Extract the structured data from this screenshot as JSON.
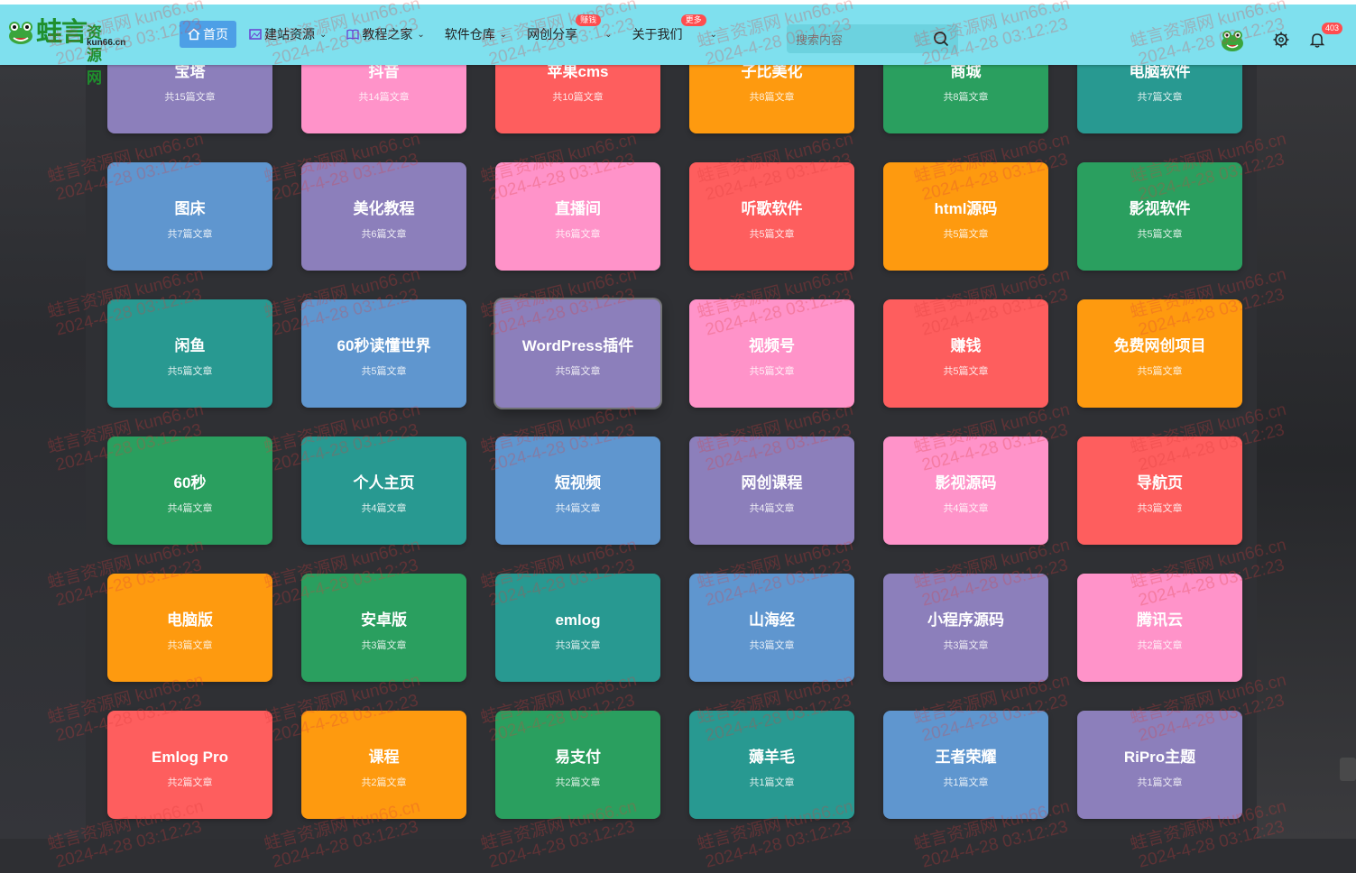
{
  "header": {
    "logo_title": "蛙言",
    "logo_top": "资源网",
    "logo_sub": "kun66.cn",
    "nav": [
      {
        "label": "首页",
        "active": true,
        "badge": ""
      },
      {
        "label": "建站资源",
        "active": false,
        "badge": ""
      },
      {
        "label": "教程之家",
        "active": false,
        "badge": ""
      },
      {
        "label": "软件仓库",
        "active": false,
        "badge": ""
      },
      {
        "label": "网创分享",
        "active": false,
        "badge": "赚钱"
      },
      {
        "label": "关于我们",
        "active": false,
        "badge": "更多"
      }
    ],
    "search_placeholder": "搜索内容",
    "notification_count": "403"
  },
  "categories": [
    {
      "name": "宝塔",
      "count": "共15篇文章",
      "color": "#8c7fbb"
    },
    {
      "name": "抖音",
      "count": "共14篇文章",
      "color": "#ff93c9"
    },
    {
      "name": "苹果cms",
      "count": "共10篇文章",
      "color": "#fe5e5e"
    },
    {
      "name": "子比美化",
      "count": "共8篇文章",
      "color": "#fe9a0f"
    },
    {
      "name": "商城",
      "count": "共8篇文章",
      "color": "#2a9f5f"
    },
    {
      "name": "电脑软件",
      "count": "共7篇文章",
      "color": "#289991"
    },
    {
      "name": "图床",
      "count": "共7篇文章",
      "color": "#5f96cf"
    },
    {
      "name": "美化教程",
      "count": "共6篇文章",
      "color": "#8c7fbb"
    },
    {
      "name": "直播间",
      "count": "共6篇文章",
      "color": "#ff93c9"
    },
    {
      "name": "听歌软件",
      "count": "共5篇文章",
      "color": "#fe5e5e"
    },
    {
      "name": "html源码",
      "count": "共5篇文章",
      "color": "#fe9a0f"
    },
    {
      "name": "影视软件",
      "count": "共5篇文章",
      "color": "#2a9f5f"
    },
    {
      "name": "闲鱼",
      "count": "共5篇文章",
      "color": "#289991"
    },
    {
      "name": "60秒读懂世界",
      "count": "共5篇文章",
      "color": "#5f96cf"
    },
    {
      "name": "WordPress插件",
      "count": "共5篇文章",
      "color": "#8c7fbb"
    },
    {
      "name": "视频号",
      "count": "共5篇文章",
      "color": "#ff93c9"
    },
    {
      "name": "赚钱",
      "count": "共5篇文章",
      "color": "#fe5e5e"
    },
    {
      "name": "免费网创项目",
      "count": "共5篇文章",
      "color": "#fe9a0f"
    },
    {
      "name": "60秒",
      "count": "共4篇文章",
      "color": "#2a9f5f"
    },
    {
      "name": "个人主页",
      "count": "共4篇文章",
      "color": "#289991"
    },
    {
      "name": "短视频",
      "count": "共4篇文章",
      "color": "#5f96cf"
    },
    {
      "name": "网创课程",
      "count": "共4篇文章",
      "color": "#8c7fbb"
    },
    {
      "name": "影视源码",
      "count": "共4篇文章",
      "color": "#ff93c9"
    },
    {
      "name": "导航页",
      "count": "共3篇文章",
      "color": "#fe5e5e"
    },
    {
      "name": "电脑版",
      "count": "共3篇文章",
      "color": "#fe9a0f"
    },
    {
      "name": "安卓版",
      "count": "共3篇文章",
      "color": "#2a9f5f"
    },
    {
      "name": "emlog",
      "count": "共3篇文章",
      "color": "#289991"
    },
    {
      "name": "山海经",
      "count": "共3篇文章",
      "color": "#5f96cf"
    },
    {
      "name": "小程序源码",
      "count": "共3篇文章",
      "color": "#8c7fbb"
    },
    {
      "name": "腾讯云",
      "count": "共2篇文章",
      "color": "#ff93c9"
    },
    {
      "name": "Emlog Pro",
      "count": "共2篇文章",
      "color": "#fe5e5e"
    },
    {
      "name": "课程",
      "count": "共2篇文章",
      "color": "#fe9a0f"
    },
    {
      "name": "易支付",
      "count": "共2篇文章",
      "color": "#2a9f5f"
    },
    {
      "name": "薅羊毛",
      "count": "共1篇文章",
      "color": "#289991"
    },
    {
      "name": "王者荣耀",
      "count": "共1篇文章",
      "color": "#5f96cf"
    },
    {
      "name": "RiPro主题",
      "count": "共1篇文章",
      "color": "#8c7fbb"
    }
  ],
  "watermark": [
    "蛙言资源网 kun66.cn",
    "2024-4-28 03:12:23"
  ]
}
